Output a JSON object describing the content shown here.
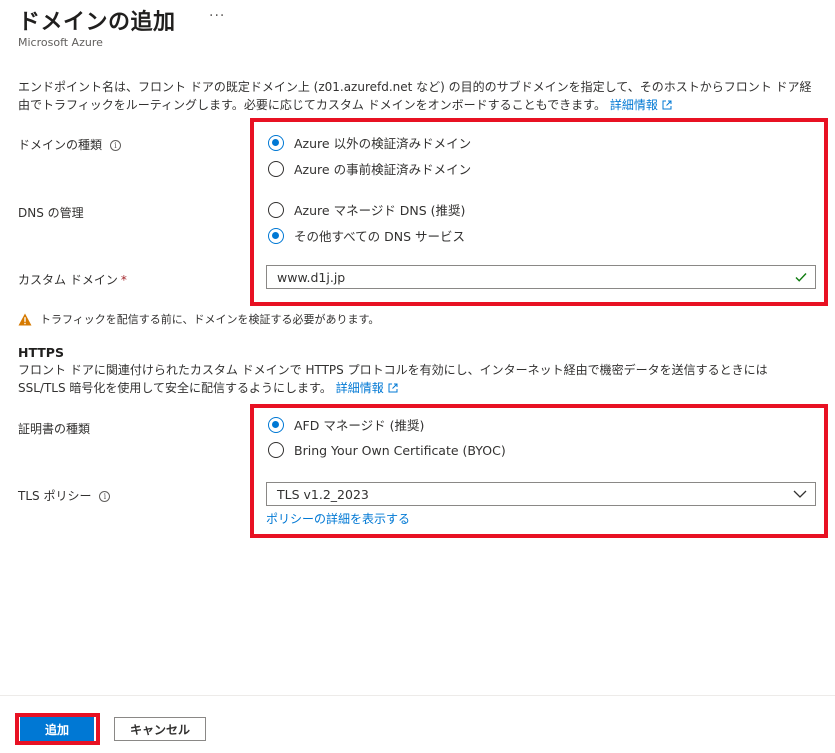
{
  "header": {
    "title": "ドメインの追加",
    "more": "···",
    "subtitle": "Microsoft Azure"
  },
  "description": {
    "text": "エンドポイント名は、フロント ドアの既定ドメイン上 (z01.azurefd.net など) の目的のサブドメインを指定して、そのホストからフロント ドア経由でトラフィックをルーティングします。必要に応じてカスタム ドメインをオンボードすることもできます。",
    "link": "詳細情報"
  },
  "domain_type": {
    "label": "ドメインの種類",
    "info": "i",
    "options": [
      {
        "label": "Azure 以外の検証済みドメイン",
        "selected": true
      },
      {
        "label": "Azure の事前検証済みドメイン",
        "selected": false
      }
    ]
  },
  "dns": {
    "label": "DNS の管理",
    "options": [
      {
        "label": "Azure マネージド DNS (推奨)",
        "selected": false
      },
      {
        "label": "その他すべての DNS サービス",
        "selected": true
      }
    ]
  },
  "custom_domain": {
    "label": "カスタム ドメイン",
    "required_mark": "*",
    "value": "www.d1j.jp"
  },
  "warning": {
    "text": "トラフィックを配信する前に、ドメインを検証する必要があります。"
  },
  "https": {
    "heading": "HTTPS",
    "text": "フロント ドアに関連付けられたカスタム ドメインで HTTPS プロトコルを有効にし、インターネット経由で機密データを送信するときには SSL/TLS 暗号化を使用して安全に配信するようにします。",
    "link": "詳細情報"
  },
  "cert": {
    "label": "証明書の種類",
    "options": [
      {
        "label": "AFD マネージド (推奨)",
        "selected": true
      },
      {
        "label": "Bring Your Own Certificate (BYOC)",
        "selected": false
      }
    ]
  },
  "tls": {
    "label": "TLS ポリシー",
    "info": "i",
    "value": "TLS v1.2_2023",
    "link": "ポリシーの詳細を表示する"
  },
  "footer": {
    "add": "追加",
    "cancel": "キャンセル"
  },
  "colors": {
    "accent": "#0078d4",
    "highlight": "#e81123",
    "warning": "#d67a00",
    "success": "#107c10"
  }
}
